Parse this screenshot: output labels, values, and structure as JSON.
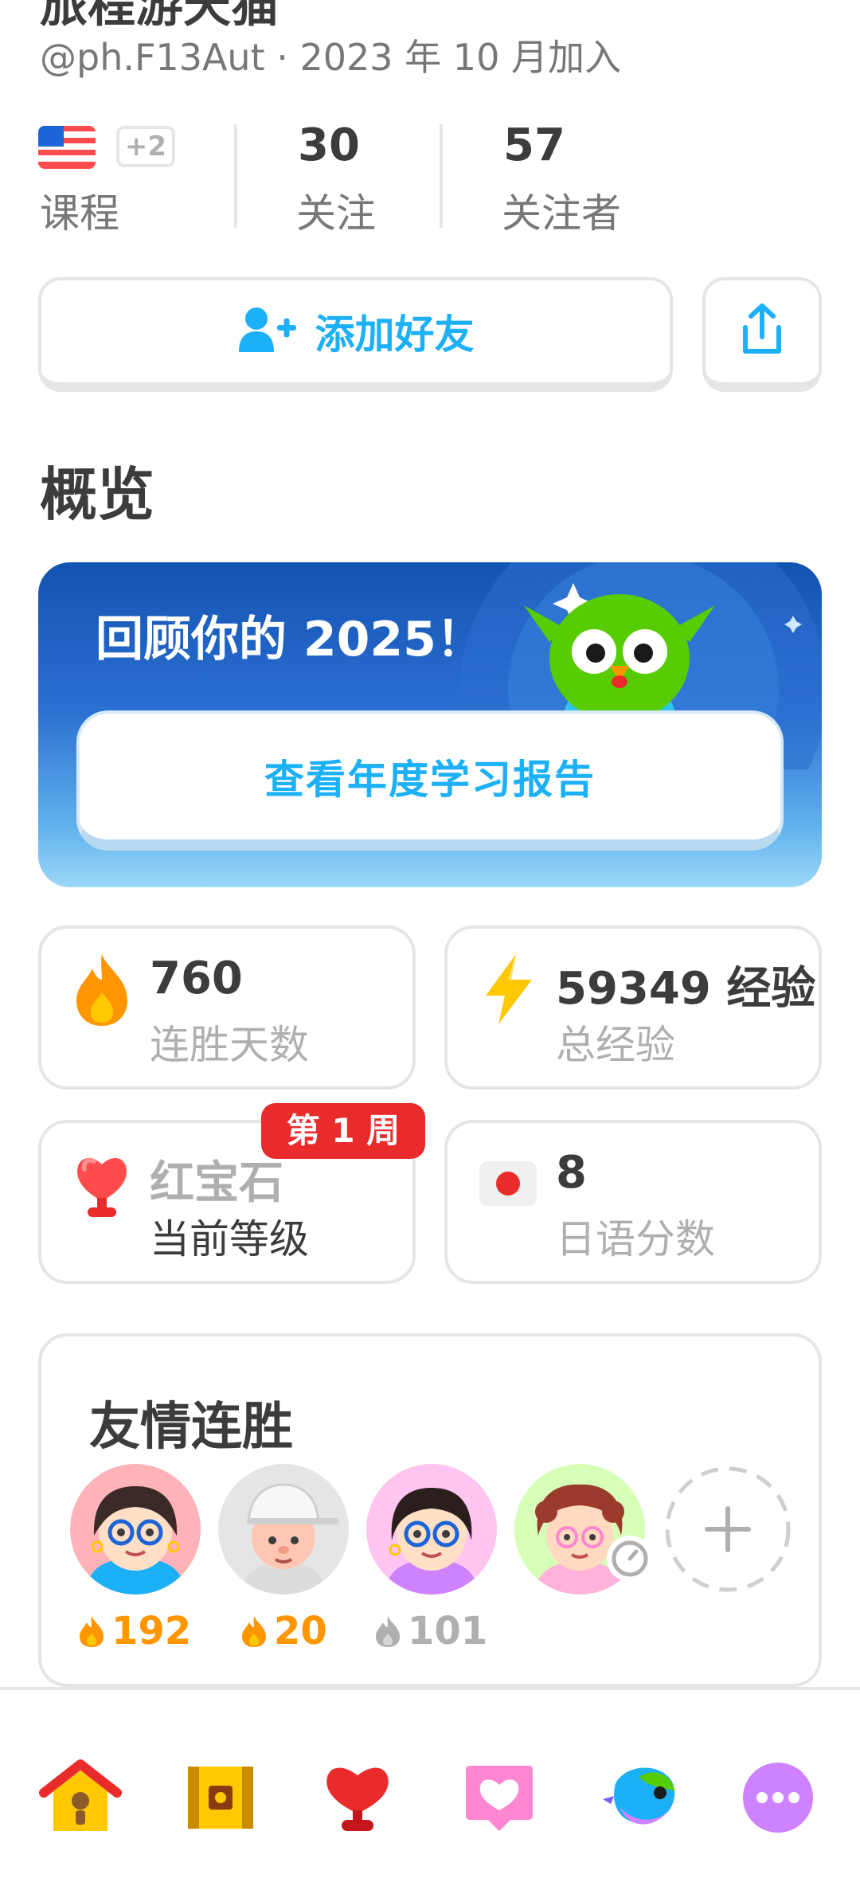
{
  "profile": {
    "name": "旅程游天猫",
    "handle": "@ph.F13Aut · 2023 年 10 月加入",
    "courses_extra": "+2",
    "courses_label": "课程",
    "following_count": "30",
    "following_label": "关注",
    "followers_count": "57",
    "followers_label": "关注者"
  },
  "actions": {
    "add_friend": "添加好友"
  },
  "overview": {
    "title": "概览",
    "year_review_title": "回顾你的 2025！",
    "year_review_button": "查看年度学习报告",
    "stats": [
      {
        "value": "760",
        "label": "连胜天数",
        "icon": "fire-icon"
      },
      {
        "value": "59349 经验",
        "label": "总经验",
        "icon": "lightning-icon"
      },
      {
        "value": "红宝石",
        "label": "当前等级",
        "icon": "ruby-trophy-icon",
        "badge": "第 1 周"
      },
      {
        "value": "8",
        "label": "日语分数",
        "icon": "japan-flag-icon"
      }
    ]
  },
  "friend_streaks": {
    "title": "友情连胜",
    "friends": [
      {
        "streak": "192",
        "active": true
      },
      {
        "streak": "20",
        "active": true
      },
      {
        "streak": "101",
        "active": false
      },
      {
        "streak": "",
        "pending": true
      }
    ]
  },
  "colors": {
    "accent_blue": "#1cb0f6",
    "streak_orange": "#ff9600",
    "badge_red": "#ea2b2b",
    "inactive_gray": "#afafaf"
  },
  "nav": [
    "home-icon",
    "chest-icon",
    "leaderboard-icon",
    "hearts-icon",
    "duo-bird-icon",
    "more-icon"
  ]
}
